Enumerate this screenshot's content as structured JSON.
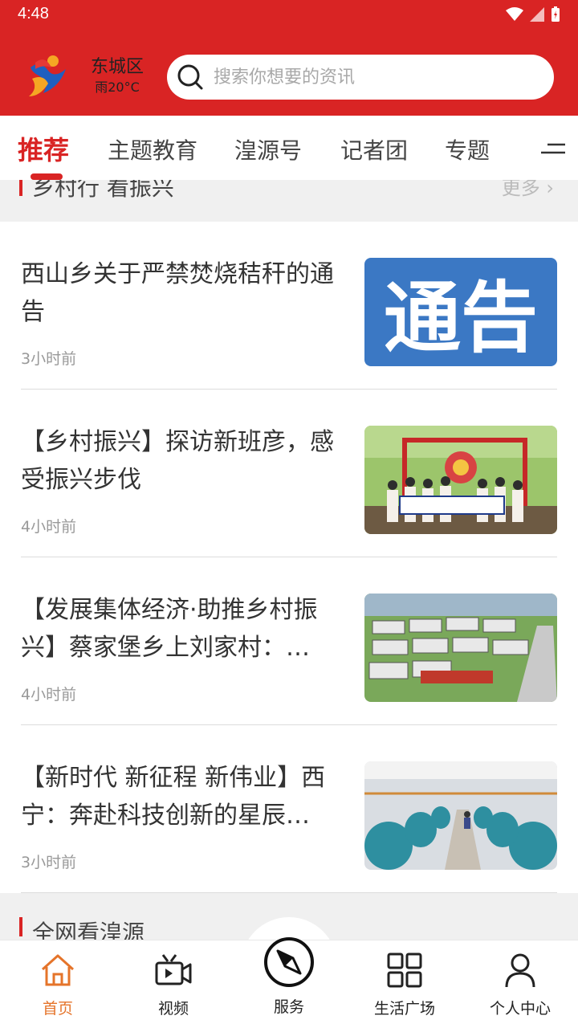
{
  "status_bar": {
    "time": "4:48"
  },
  "header": {
    "location_name": "东城区",
    "weather": "雨20°C",
    "search_placeholder": "搜索你想要的资讯"
  },
  "tabs": [
    {
      "label": "推荐",
      "active": true
    },
    {
      "label": "主题教育"
    },
    {
      "label": "湟源号"
    },
    {
      "label": "记者团"
    },
    {
      "label": "专题"
    }
  ],
  "section_top": {
    "title": "乡村行  看振兴",
    "more": "更多 ›"
  },
  "news": [
    {
      "title": "西山乡关于严禁焚烧秸秆的通告",
      "time": "3小时前",
      "image": "notice-banner"
    },
    {
      "title": "【乡村振兴】探访新班彦，感受振兴步伐",
      "time": "4小时前",
      "image": "group-photo"
    },
    {
      "title": "【发展集体经济·助推乡村振兴】蔡家堡乡上刘家村：…",
      "time": "4小时前",
      "image": "village-aerial"
    },
    {
      "title": "【新时代  新征程  新伟业】西宁：奔赴科技创新的星辰…",
      "time": "3小时前",
      "image": "factory-interior"
    }
  ],
  "thumb_text": {
    "notice": "通告"
  },
  "section_bottom": {
    "title": "全网看湟源"
  },
  "bottom_nav": [
    {
      "label": "首页",
      "icon": "home-icon",
      "active": true
    },
    {
      "label": "视频",
      "icon": "video-icon"
    },
    {
      "label": "服务",
      "icon": "compass-icon"
    },
    {
      "label": "生活广场",
      "icon": "grid-icon"
    },
    {
      "label": "个人中心",
      "icon": "person-icon"
    }
  ],
  "colors": {
    "brand_red": "#d92424",
    "active_nav": "#e5742a"
  }
}
